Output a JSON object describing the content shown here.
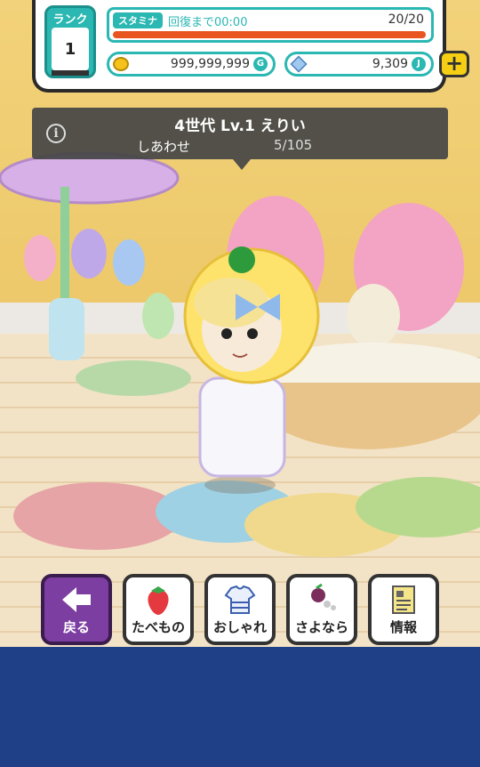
{
  "hud": {
    "rank_label": "ランク",
    "rank_value": "1",
    "stamina_tag": "スタミナ",
    "stamina_recover": "回復まで00:00",
    "stamina_count": "20/20",
    "stamina_fraction": 1.0,
    "coins": "999,999,999",
    "coin_unit": "G",
    "jewels": "9,309",
    "jewel_unit": "J",
    "plus_symbol": "+"
  },
  "info": {
    "title": "4世代 Lv.1 えりい",
    "label": "しあわせ",
    "value": "5/105"
  },
  "buttons": {
    "back": "戻る",
    "food": "たべもの",
    "fashion": "おしゃれ",
    "goodbye": "さよなら",
    "info": "情報"
  },
  "colors": {
    "accent": "#2bb7b2",
    "stamina_fill": "#e8551e",
    "back_button": "#7d3ea2",
    "bottom_panel": "#1f3f86"
  },
  "icons": {
    "back": "arrow-left-icon",
    "food": "strawberry-icon",
    "fashion": "clothes-icon",
    "goodbye": "grape-icon",
    "info": "document-icon"
  }
}
